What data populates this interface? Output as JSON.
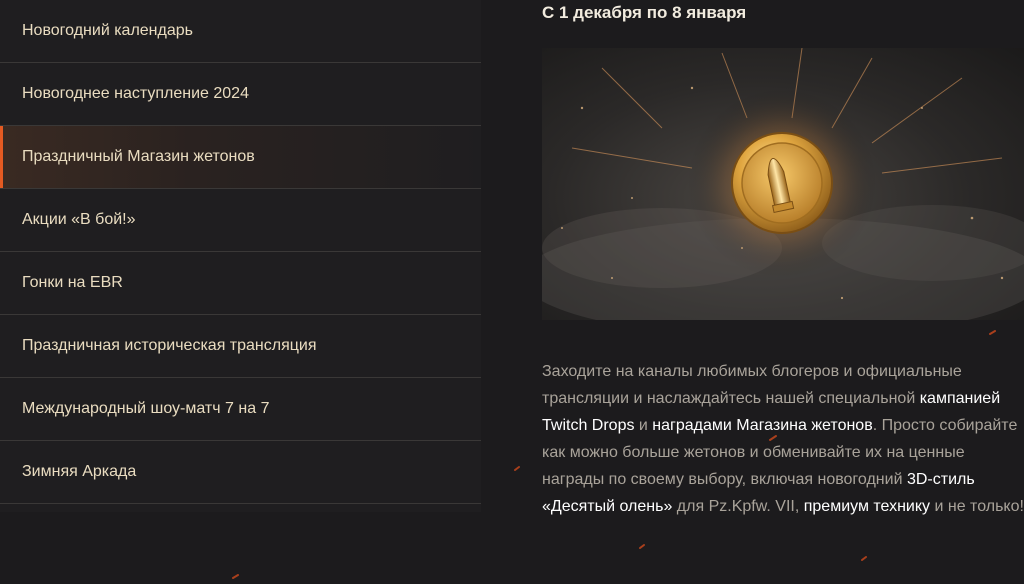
{
  "sidebar": {
    "items": [
      {
        "label": "Новогодний календарь"
      },
      {
        "label": "Новогоднее наступление 2024"
      },
      {
        "label": "Праздничный Магазин жетонов",
        "active": true
      },
      {
        "label": "Акции «В бой!»"
      },
      {
        "label": "Гонки на EBR"
      },
      {
        "label": "Праздничная историческая трансляция"
      },
      {
        "label": "Международный шоу-матч 7 на 7"
      },
      {
        "label": "Зимняя Аркада"
      }
    ]
  },
  "content": {
    "date": "С 1 декабря по 8 января",
    "hero_icon": "token-coin-icon",
    "description": {
      "t1": "Заходите на каналы любимых блогеров и официальные трансляции и наслаждайтесь нашей специальной ",
      "h1": "кампанией Twitch Drops",
      "t2": " и ",
      "h2": "наградами Магазина жетонов",
      "t3": ". Просто собирайте как можно больше жетонов и обменивайте их на ценные награды по своему выбору, включая новогодний ",
      "h3": "3D-стиль «Десятый олень»",
      "t4": " для Pz.Kpfw. VII, ",
      "h4": "премиум технику",
      "t5": " и не только!"
    }
  },
  "colors": {
    "background": "#1c1b1d",
    "accent": "#e45a22",
    "menu_text": "#e9dcc0",
    "body_text": "#a9a39a",
    "highlight_text": "#ffffff",
    "coin_gold": "#d9a441"
  }
}
